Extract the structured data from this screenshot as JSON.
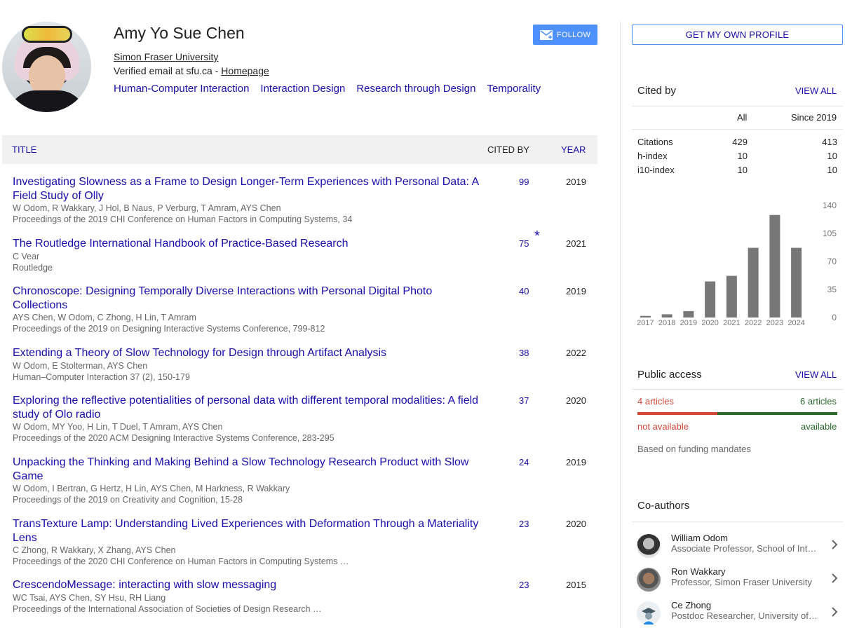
{
  "profile": {
    "name": "Amy Yo Sue Chen",
    "affiliation": "Simon Fraser University",
    "email_prefix": "Verified email at sfu.ca - ",
    "homepage_label": "Homepage",
    "interests": [
      "Human-Computer Interaction",
      "Interaction Design",
      "Research through Design",
      "Temporality"
    ],
    "follow_label": "FOLLOW"
  },
  "table": {
    "headers": {
      "title": "TITLE",
      "cited_by": "CITED BY",
      "year": "YEAR"
    },
    "rows": [
      {
        "title": "Investigating Slowness as a Frame to Design Longer-Term Experiences with Personal Data: A Field Study of Olly",
        "authors": "W Odom, R Wakkary, J Hol, B Naus, P Verburg, T Amram, AYS Chen",
        "venue": "Proceedings of the 2019 CHI Conference on Human Factors in Computing Systems, 34",
        "cited": "99",
        "year": "2019",
        "star": ""
      },
      {
        "title": "The Routledge International Handbook of Practice-Based Research",
        "authors": "C Vear",
        "venue": "Routledge",
        "cited": "75",
        "year": "2021",
        "star": "*"
      },
      {
        "title": "Chronoscope: Designing Temporally Diverse Interactions with Personal Digital Photo Collections",
        "authors": "AYS Chen, W Odom, C Zhong, H Lin, T Amram",
        "venue": "Proceedings of the 2019 on Designing Interactive Systems Conference, 799-812",
        "cited": "40",
        "year": "2019",
        "star": ""
      },
      {
        "title": "Extending a Theory of Slow Technology for Design through Artifact Analysis",
        "authors": "W Odom, E Stolterman, AYS Chen",
        "venue": "Human–Computer Interaction 37 (2), 150-179",
        "cited": "38",
        "year": "2022",
        "star": ""
      },
      {
        "title": "Exploring the reflective potentialities of personal data with different temporal modalities: A field study of Olo radio",
        "authors": "W Odom, MY Yoo, H Lin, T Duel, T Amram, AYS Chen",
        "venue": "Proceedings of the 2020 ACM Designing Interactive Systems Conference, 283-295",
        "cited": "37",
        "year": "2020",
        "star": ""
      },
      {
        "title": "Unpacking the Thinking and Making Behind a Slow Technology Research Product with Slow Game",
        "authors": "W Odom, I Bertran, G Hertz, H Lin, AYS Chen, M Harkness, R Wakkary",
        "venue": "Proceedings of the 2019 on Creativity and Cognition, 15-28",
        "cited": "24",
        "year": "2019",
        "star": ""
      },
      {
        "title": "TransTexture Lamp: Understanding Lived Experiences with Deformation Through a Materiality Lens",
        "authors": "C Zhong, R Wakkary, X Zhang, AYS Chen",
        "venue": "Proceedings of the 2020 CHI Conference on Human Factors in Computing Systems …",
        "cited": "23",
        "year": "2020",
        "star": ""
      },
      {
        "title": "CrescendoMessage: interacting with slow messaging",
        "authors": "WC Tsai, AYS Chen, SY Hsu, RH Liang",
        "venue": "Proceedings of the International Association of Societies of Design Research …",
        "cited": "23",
        "year": "2015",
        "star": ""
      }
    ]
  },
  "sidebar": {
    "get_profile_label": "GET MY OWN PROFILE",
    "cited_by": {
      "title": "Cited by",
      "view_all": "VIEW ALL",
      "col_all": "All",
      "col_since": "Since 2019",
      "rows": [
        {
          "label": "Citations",
          "all": "429",
          "since": "413"
        },
        {
          "label": "h-index",
          "all": "10",
          "since": "10"
        },
        {
          "label": "i10-index",
          "all": "10",
          "since": "10"
        }
      ]
    },
    "public_access": {
      "title": "Public access",
      "view_all": "VIEW ALL",
      "not_available_count": "4 articles",
      "available_count": "6 articles",
      "not_available_label": "not available",
      "available_label": "available",
      "note": "Based on funding mandates",
      "not_available_color": "#d14836",
      "available_color": "#2b6a2b",
      "available_fraction": 0.6
    },
    "coauthors": {
      "title": "Co-authors",
      "items": [
        {
          "name": "William Odom",
          "desc": "Associate Professor, School of Interactive Arts and Technology"
        },
        {
          "name": "Ron Wakkary",
          "desc": "Professor, Simon Fraser University"
        },
        {
          "name": "Ce Zhong",
          "desc": "Postdoc Researcher, University of Washington"
        }
      ]
    }
  },
  "chart_data": {
    "type": "bar",
    "categories": [
      "2017",
      "2018",
      "2019",
      "2020",
      "2021",
      "2022",
      "2023",
      "2024"
    ],
    "values": [
      2,
      4,
      8,
      45,
      52,
      87,
      128,
      87
    ],
    "ylim": [
      0,
      140
    ],
    "yticks": [
      "0",
      "35",
      "70",
      "105",
      "140"
    ],
    "bar_color": "#777777",
    "grid": false
  }
}
